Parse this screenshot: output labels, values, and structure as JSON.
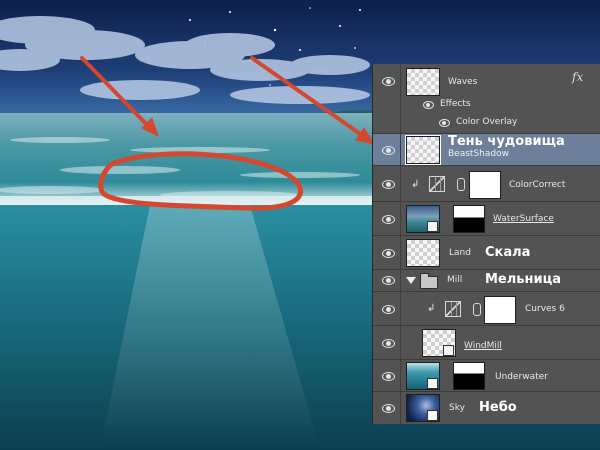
{
  "panel": {
    "fx_label": "fx",
    "layers": [
      {
        "id": "waves",
        "label": "Waves",
        "effects_label": "Effects",
        "effect_name": "Color Overlay"
      },
      {
        "id": "beast",
        "label": "BeastShadow",
        "annotation": "Тень чудовища",
        "selected": true
      },
      {
        "id": "color",
        "label": "ColorCorrect"
      },
      {
        "id": "water",
        "label": "WaterSurface"
      },
      {
        "id": "land",
        "label": "Land",
        "annotation": "Скала"
      },
      {
        "id": "mill",
        "label": "Mill",
        "annotation": "Мельница",
        "group": true
      },
      {
        "id": "curves",
        "label": "Curves 6"
      },
      {
        "id": "windmill",
        "label": "WindMill"
      },
      {
        "id": "under",
        "label": "Underwater"
      },
      {
        "id": "sky",
        "label": "Sky",
        "annotation": "Небо"
      }
    ]
  },
  "colors": {
    "annotation_red": "#d4482f",
    "selected_row": "#6d7f9b",
    "panel_bg": "#535353"
  },
  "icons": [
    "eye-icon",
    "fx-icon",
    "link-icon",
    "adjustment-icon",
    "folder-icon",
    "smart-object-icon",
    "clip-arrow-icon"
  ]
}
